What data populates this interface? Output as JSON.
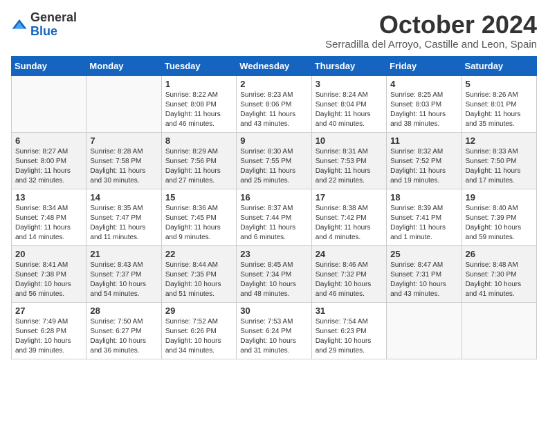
{
  "logo": {
    "general": "General",
    "blue": "Blue"
  },
  "title": "October 2024",
  "subtitle": "Serradilla del Arroyo, Castille and Leon, Spain",
  "weekdays": [
    "Sunday",
    "Monday",
    "Tuesday",
    "Wednesday",
    "Thursday",
    "Friday",
    "Saturday"
  ],
  "weeks": [
    [
      {
        "day": "",
        "info": ""
      },
      {
        "day": "",
        "info": ""
      },
      {
        "day": "1",
        "info": "Sunrise: 8:22 AM\nSunset: 8:08 PM\nDaylight: 11 hours and 46 minutes."
      },
      {
        "day": "2",
        "info": "Sunrise: 8:23 AM\nSunset: 8:06 PM\nDaylight: 11 hours and 43 minutes."
      },
      {
        "day": "3",
        "info": "Sunrise: 8:24 AM\nSunset: 8:04 PM\nDaylight: 11 hours and 40 minutes."
      },
      {
        "day": "4",
        "info": "Sunrise: 8:25 AM\nSunset: 8:03 PM\nDaylight: 11 hours and 38 minutes."
      },
      {
        "day": "5",
        "info": "Sunrise: 8:26 AM\nSunset: 8:01 PM\nDaylight: 11 hours and 35 minutes."
      }
    ],
    [
      {
        "day": "6",
        "info": "Sunrise: 8:27 AM\nSunset: 8:00 PM\nDaylight: 11 hours and 32 minutes."
      },
      {
        "day": "7",
        "info": "Sunrise: 8:28 AM\nSunset: 7:58 PM\nDaylight: 11 hours and 30 minutes."
      },
      {
        "day": "8",
        "info": "Sunrise: 8:29 AM\nSunset: 7:56 PM\nDaylight: 11 hours and 27 minutes."
      },
      {
        "day": "9",
        "info": "Sunrise: 8:30 AM\nSunset: 7:55 PM\nDaylight: 11 hours and 25 minutes."
      },
      {
        "day": "10",
        "info": "Sunrise: 8:31 AM\nSunset: 7:53 PM\nDaylight: 11 hours and 22 minutes."
      },
      {
        "day": "11",
        "info": "Sunrise: 8:32 AM\nSunset: 7:52 PM\nDaylight: 11 hours and 19 minutes."
      },
      {
        "day": "12",
        "info": "Sunrise: 8:33 AM\nSunset: 7:50 PM\nDaylight: 11 hours and 17 minutes."
      }
    ],
    [
      {
        "day": "13",
        "info": "Sunrise: 8:34 AM\nSunset: 7:48 PM\nDaylight: 11 hours and 14 minutes."
      },
      {
        "day": "14",
        "info": "Sunrise: 8:35 AM\nSunset: 7:47 PM\nDaylight: 11 hours and 11 minutes."
      },
      {
        "day": "15",
        "info": "Sunrise: 8:36 AM\nSunset: 7:45 PM\nDaylight: 11 hours and 9 minutes."
      },
      {
        "day": "16",
        "info": "Sunrise: 8:37 AM\nSunset: 7:44 PM\nDaylight: 11 hours and 6 minutes."
      },
      {
        "day": "17",
        "info": "Sunrise: 8:38 AM\nSunset: 7:42 PM\nDaylight: 11 hours and 4 minutes."
      },
      {
        "day": "18",
        "info": "Sunrise: 8:39 AM\nSunset: 7:41 PM\nDaylight: 11 hours and 1 minute."
      },
      {
        "day": "19",
        "info": "Sunrise: 8:40 AM\nSunset: 7:39 PM\nDaylight: 10 hours and 59 minutes."
      }
    ],
    [
      {
        "day": "20",
        "info": "Sunrise: 8:41 AM\nSunset: 7:38 PM\nDaylight: 10 hours and 56 minutes."
      },
      {
        "day": "21",
        "info": "Sunrise: 8:43 AM\nSunset: 7:37 PM\nDaylight: 10 hours and 54 minutes."
      },
      {
        "day": "22",
        "info": "Sunrise: 8:44 AM\nSunset: 7:35 PM\nDaylight: 10 hours and 51 minutes."
      },
      {
        "day": "23",
        "info": "Sunrise: 8:45 AM\nSunset: 7:34 PM\nDaylight: 10 hours and 48 minutes."
      },
      {
        "day": "24",
        "info": "Sunrise: 8:46 AM\nSunset: 7:32 PM\nDaylight: 10 hours and 46 minutes."
      },
      {
        "day": "25",
        "info": "Sunrise: 8:47 AM\nSunset: 7:31 PM\nDaylight: 10 hours and 43 minutes."
      },
      {
        "day": "26",
        "info": "Sunrise: 8:48 AM\nSunset: 7:30 PM\nDaylight: 10 hours and 41 minutes."
      }
    ],
    [
      {
        "day": "27",
        "info": "Sunrise: 7:49 AM\nSunset: 6:28 PM\nDaylight: 10 hours and 39 minutes."
      },
      {
        "day": "28",
        "info": "Sunrise: 7:50 AM\nSunset: 6:27 PM\nDaylight: 10 hours and 36 minutes."
      },
      {
        "day": "29",
        "info": "Sunrise: 7:52 AM\nSunset: 6:26 PM\nDaylight: 10 hours and 34 minutes."
      },
      {
        "day": "30",
        "info": "Sunrise: 7:53 AM\nSunset: 6:24 PM\nDaylight: 10 hours and 31 minutes."
      },
      {
        "day": "31",
        "info": "Sunrise: 7:54 AM\nSunset: 6:23 PM\nDaylight: 10 hours and 29 minutes."
      },
      {
        "day": "",
        "info": ""
      },
      {
        "day": "",
        "info": ""
      }
    ]
  ]
}
